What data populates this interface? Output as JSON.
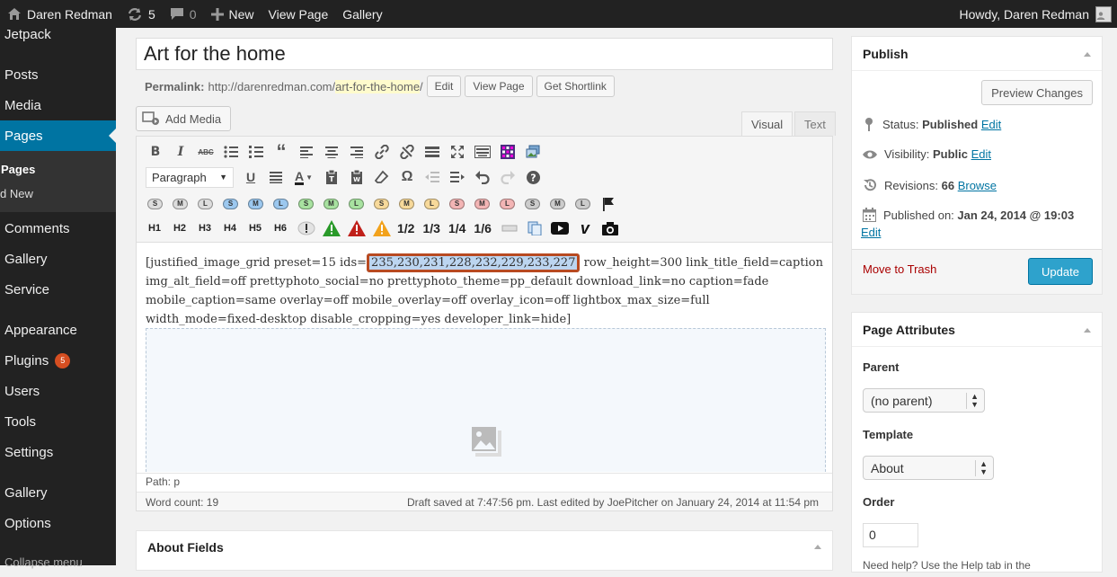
{
  "admin_bar": {
    "site_name": "Daren Redman",
    "updates_count": "5",
    "comments_count": "0",
    "new_label": "New",
    "view_page_label": "View Page",
    "gallery_label": "Gallery",
    "howdy": "Howdy, Daren Redman"
  },
  "sidebar": {
    "items": [
      {
        "label": "Jetpack"
      },
      {
        "label": "Posts"
      },
      {
        "label": "Media"
      },
      {
        "label": "Pages"
      },
      {
        "label": "Comments"
      },
      {
        "label": "Gallery"
      },
      {
        "label": "Service"
      },
      {
        "label": "Appearance"
      },
      {
        "label": "Plugins",
        "badge": "5"
      },
      {
        "label": "Users"
      },
      {
        "label": "Tools"
      },
      {
        "label": "Settings"
      },
      {
        "label": "Gallery"
      },
      {
        "label": "Options"
      },
      {
        "label": "Collapse menu"
      }
    ],
    "submenu": [
      "Pages",
      "d New"
    ]
  },
  "editor": {
    "title": "Art for the home",
    "permalink_label": "Permalink:",
    "permalink_base": "http://darenredman.com/",
    "permalink_slug": "art-for-the-home",
    "permalink_trail": "/",
    "edit_btn": "Edit",
    "view_page_btn": "View Page",
    "shortlink_btn": "Get Shortlink",
    "add_media": "Add Media",
    "tab_visual": "Visual",
    "tab_text": "Text",
    "format_select": "Paragraph",
    "shortcode_letters": [
      "S",
      "M",
      "L",
      "S",
      "M",
      "L",
      "S",
      "M",
      "L",
      "S",
      "M",
      "L",
      "S",
      "M",
      "L",
      "S",
      "M",
      "L"
    ],
    "headings": [
      "H1",
      "H2",
      "H3",
      "H4",
      "H5",
      "H6"
    ],
    "fractions": [
      "1/2",
      "1/3",
      "1/4",
      "1/6"
    ],
    "content_before": "[justified_image_grid preset=15 ids=",
    "content_ids": "235,230,231,228,232,229,233,227",
    "content_after": " row_height=300 link_title_field=caption img_alt_field=off prettyphoto_social=no prettyphoto_theme=pp_default download_link=no caption=fade mobile_caption=same overlay=off mobile_overlay=off overlay_icon=off lightbox_max_size=full width_mode=fixed-desktop disable_cropping=yes developer_link=hide]",
    "path": "Path: p",
    "word_count": "Word count: 19",
    "draft_status": "Draft saved at 7:47:56 pm. Last edited by JoePitcher on January 24, 2014 at 11:54 pm"
  },
  "about_fields": {
    "title": "About Fields"
  },
  "publish": {
    "title": "Publish",
    "preview_btn": "Preview Changes",
    "status_label": "Status:",
    "status_value": "Published",
    "visibility_label": "Visibility:",
    "visibility_value": "Public",
    "revisions_label": "Revisions:",
    "revisions_value": "66",
    "browse": "Browse",
    "published_label": "Published on:",
    "published_value": "Jan 24, 2014 @ 19:03",
    "edit": "Edit",
    "trash": "Move to Trash",
    "update": "Update"
  },
  "attributes": {
    "title": "Page Attributes",
    "parent_label": "Parent",
    "parent_value": "(no parent)",
    "template_label": "Template",
    "template_value": "About",
    "order_label": "Order",
    "order_value": "0",
    "help": "Need help? Use the Help tab in the"
  },
  "colors": {
    "admin_dark": "#222222",
    "current_menu": "#0074a2",
    "update_button": "#2ea2cc",
    "selection_border": "#b84a21"
  }
}
